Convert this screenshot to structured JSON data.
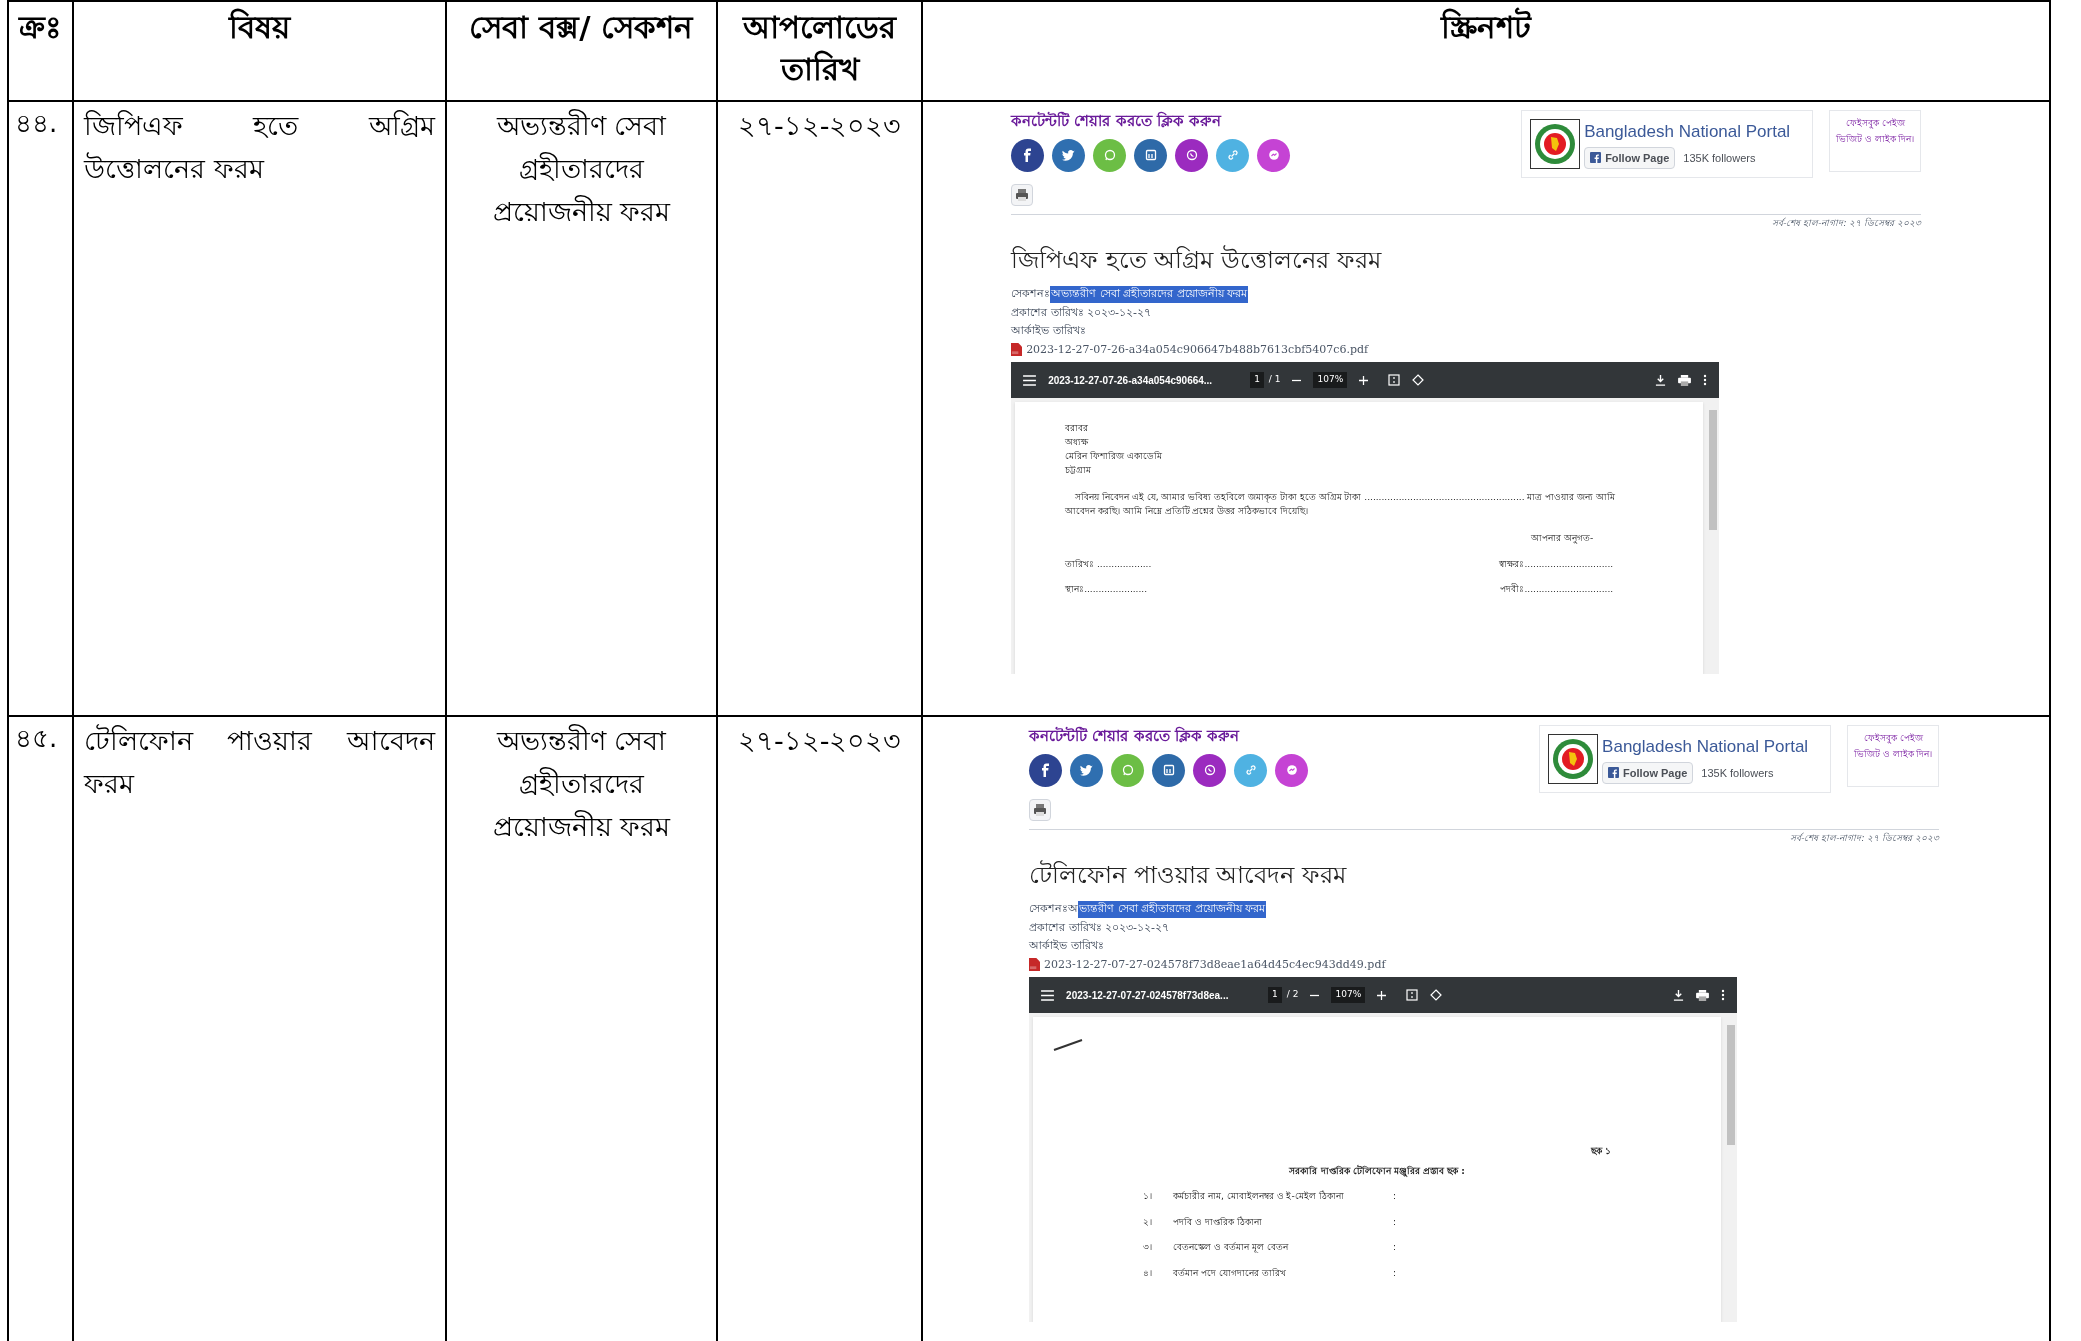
{
  "table": {
    "columns": [
      "ক্রঃ",
      "বিষয়",
      "সেবা বক্স/ সেকশন",
      "আপলোডের তারিখ",
      "স্ক্রিনশট"
    ],
    "rows": [
      {
        "serial": "৪৪.",
        "subject": "জিপিএফ হতে অগ্রিম উত্তোলনের ফরম",
        "section": "অভ্যন্তরীণ সেবা গ্রহীতারদের প্রয়োজনীয় ফরম",
        "upload_date": "২৭-১২-২০২৩",
        "screenshot": {
          "share_label": "কনটেন্টটি শেয়ার করতে ক্লিক করুন",
          "fb_widget": {
            "page_name": "Bangladesh National Portal",
            "follow_button": "Follow Page",
            "followers": "135K followers"
          },
          "fb_note": "ফেইসবুক পেইজ ভিজিট ও লাইক দিন।",
          "updated": "সর্ব-শেষ হাল-নাগাদ: ২৭ ডিসেম্বর ২০২৩",
          "title": "জিপিএফ হতে অগ্রিম উত্তোলনের ফরম",
          "section_label": "সেকশনঃ",
          "section_value": "অভ্যন্তরীণ সেবা গ্রহীতারদের প্রয়োজনীয় ফরম",
          "published": "প্রকাশের তারিখঃ ২০২৩-১২-২৭",
          "archived": "আর্কাইভ তারিখঃ",
          "file_name": "2023-12-27-07-26-a34a054c906647b488b7613cbf5407c6.pdf",
          "viewer": {
            "file": "2023-12-27-07-26-a34a054c90664...",
            "page": "1",
            "total": "/ 1",
            "zoom": "107%"
          },
          "pdf_lines": [
            {
              "kind": "left",
              "text": "বরাবর"
            },
            {
              "kind": "left",
              "text": "অধ্যক্ষ"
            },
            {
              "kind": "left",
              "text": "মেরিন ফিশারিজ একাডেমি"
            },
            {
              "kind": "left",
              "text": "চট্টগ্রাম"
            },
            {
              "kind": "paragraph",
              "text": "সবিনয় নিবেদন এই যে, আমার ভবিষ্য তহবিলে জমাকৃত টাকা হতে অগ্রিম টাকা ........................................................ মাত্র পাওয়ার জন্য আমি আবেদন করছি। আমি নিম্নে প্রতিটি প্রশ্নের উত্তর সঠিকভাবে দিয়েছি।"
            },
            {
              "kind": "right",
              "text": "আপনার অনুগত-"
            },
            {
              "kind": "pair",
              "text": "তারিখঃ ...................",
              "right": "স্বাক্ষরঃ..............................."
            },
            {
              "kind": "pair",
              "text": "স্থানঃ......................",
              "right": "পদবীঃ..............................."
            }
          ]
        }
      },
      {
        "serial": "৪৫.",
        "subject": "টেলিফোন পাওয়ার আবেদন ফরম",
        "section": "অভ্যন্তরীণ সেবা গ্রহীতারদের প্রয়োজনীয় ফরম",
        "upload_date": "২৭-১২-২০২৩",
        "screenshot": {
          "share_label": "কনটেন্টটি শেয়ার করতে ক্লিক করুন",
          "fb_widget": {
            "page_name": "Bangladesh National Portal",
            "follow_button": "Follow Page",
            "followers": "135K followers"
          },
          "fb_note": "ফেইসবুক পেইজ ভিজিট ও লাইক দিন।",
          "updated": "সর্ব-শেষ হাল-নাগাদ: ২৭ ডিসেম্বর ২০২৩",
          "title": "টেলিফোন পাওয়ার আবেদন ফরম",
          "section_label": "সেকশনঃ",
          "section_prefix": "অ",
          "section_value": "ভ্যন্তরীণ সেবা গ্রহীতারদের প্রয়োজনীয় ফরম",
          "published": "প্রকাশের তারিখঃ ২০২৩-১২-২৭",
          "archived": "আর্কাইভ তারিখঃ",
          "file_name": "2023-12-27-07-27-024578f73d8eae1a64d45c4ec943dd49.pdf",
          "viewer": {
            "file": "2023-12-27-07-27-024578f73d8ea...",
            "page": "1",
            "total": "/ 2",
            "zoom": "107%"
          },
          "pdf_lines": [
            {
              "kind": "mark"
            },
            {
              "kind": "right",
              "text": "ছক ১"
            },
            {
              "kind": "heading",
              "text": "সরকারি দাপ্তরিক টেলিফোন মঞ্জুরির প্রস্তাব ছক :"
            },
            {
              "kind": "item",
              "number": "১।",
              "text": "কর্মচারীর নাম, মোবাইলনম্বর ও ই-মেইল ঠিকানা",
              "right": ":"
            },
            {
              "kind": "item",
              "number": "২।",
              "text": "পদবি ও দাপ্তরিক ঠিকানা",
              "right": ":"
            },
            {
              "kind": "item",
              "number": "৩।",
              "text": "বেতনস্কেল ও বর্তমান মূল বেতন",
              "right": ":"
            },
            {
              "kind": "item",
              "number": "৪।",
              "text": "বর্তমান পদে যোগদানের তারিখ",
              "right": ":"
            }
          ]
        }
      }
    ]
  }
}
